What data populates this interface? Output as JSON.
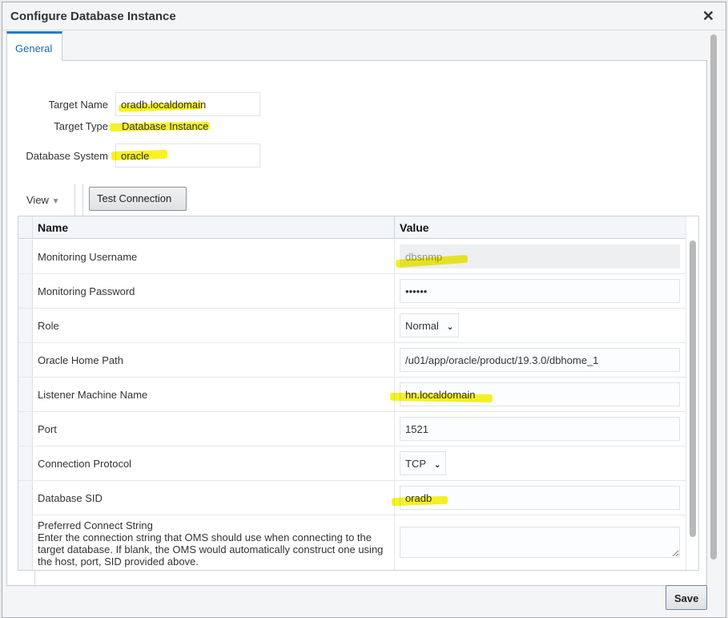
{
  "dialog": {
    "title": "Configure Database Instance",
    "close_icon": "close-icon"
  },
  "tabs": [
    {
      "label": "General",
      "active": true
    }
  ],
  "form": {
    "target_name_label": "Target Name",
    "target_name_value": "oradb.localdomain",
    "target_type_label": "Target Type",
    "target_type_value": "Database Instance",
    "database_system_label": "Database System",
    "database_system_value": "oracle"
  },
  "toolbar": {
    "view_label": "View",
    "test_connection_label": "Test Connection"
  },
  "table": {
    "columns": [
      "Name",
      "Value"
    ],
    "rows": [
      {
        "name": "Monitoring Username",
        "value": "dbsnmp",
        "type": "readonly"
      },
      {
        "name": "Monitoring Password",
        "value": "••••••",
        "type": "password"
      },
      {
        "name": "Role",
        "value": "Normal",
        "type": "select"
      },
      {
        "name": "Oracle Home Path",
        "value": "/u01/app/oracle/product/19.3.0/dbhome_1",
        "type": "text"
      },
      {
        "name": "Listener Machine Name",
        "value": "hn.localdomain",
        "type": "text"
      },
      {
        "name": "Port",
        "value": "1521",
        "type": "text"
      },
      {
        "name": "Connection Protocol",
        "value": "TCP",
        "type": "select"
      },
      {
        "name": "Database SID",
        "value": "oradb",
        "type": "text"
      }
    ],
    "connect_string": {
      "name": "Preferred Connect String",
      "description": "Enter the connection string that OMS should use when connecting to the target database. If blank, the OMS would automatically construct one using the host, port, SID provided above.",
      "value": ""
    }
  },
  "footer": {
    "save_label": "Save"
  },
  "colors": {
    "accent": "#1d7bcf",
    "highlight": "#f5f000"
  }
}
